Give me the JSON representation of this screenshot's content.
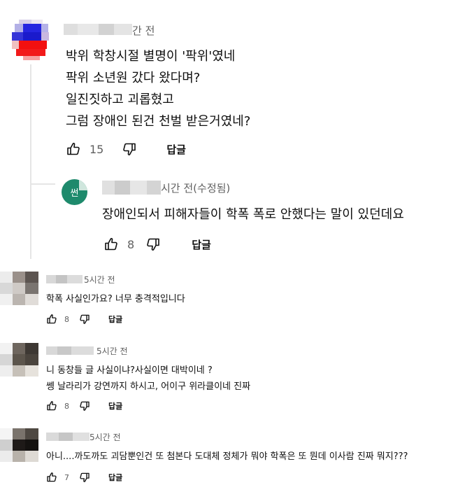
{
  "comments": [
    {
      "meta": "간 전",
      "lines": [
        "박위 학창시절 별명이 '팍위'였네",
        "팍위 소년원 갔다 왔다며?",
        "일진짓하고 괴롭혔고",
        "그럼 장애인 된건 천벌 받은거였네?"
      ],
      "likes": "15",
      "reply_label": "답글",
      "reply": {
        "avatar_initial": "썬",
        "meta": "시간 전(수정됨)",
        "lines": [
          "장애인되서  피해자들이 학폭 폭로 안했다는 말이 있던데요"
        ],
        "likes": "8",
        "reply_label": "답글"
      }
    },
    {
      "meta": "5시간 전",
      "lines": [
        "학폭 사실인가요? 너무 충격적입니다"
      ],
      "likes": "8",
      "reply_label": "답글"
    },
    {
      "meta": "5시간 전",
      "lines": [
        "니 동창들 글 사실이냐?사실이면 대박이네 ?",
        "쎙 날라리가 강연까지 하시고, 어이구 위라클이네 진짜"
      ],
      "likes": "8",
      "reply_label": "답글"
    },
    {
      "meta": "5시간 전",
      "lines": [
        "아니....까도까도 괴담뿐인건 또 첨본다 도대체 정체가 뭐야 학폭은 또 뭔데 이사람 진짜 뭐지???"
      ],
      "likes": "7",
      "reply_label": "답글"
    }
  ],
  "colors": {
    "text": "#0f0f0f",
    "meta": "#606060",
    "reply_avatar": "#1e8a6c",
    "thread_line": "#e5e5e5"
  },
  "icons": [
    "thumb-up-icon",
    "thumb-down-icon"
  ]
}
